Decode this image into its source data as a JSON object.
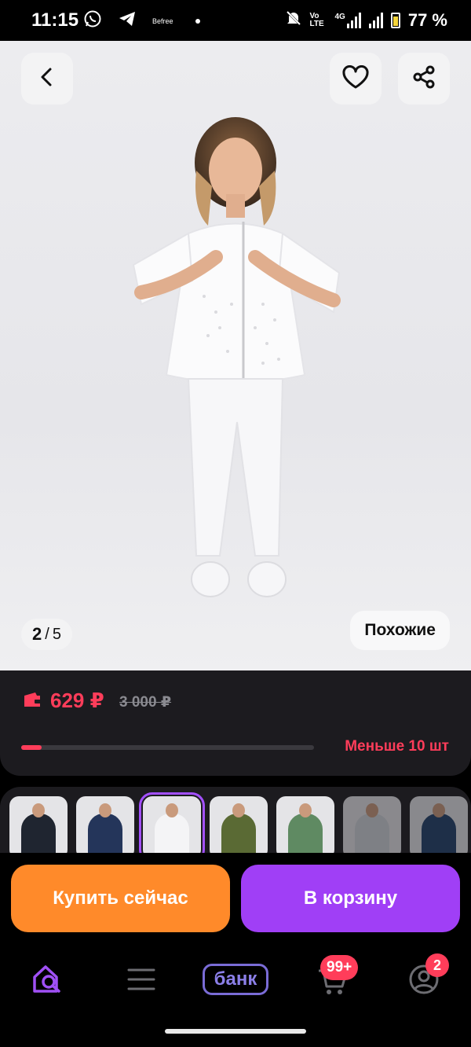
{
  "status_bar": {
    "time": "11:15",
    "small_label": "Befree",
    "network_label": "Vo LTE",
    "network_type": "4G",
    "battery": "77 %",
    "icons": [
      "whatsapp-icon",
      "telegram-icon",
      "mute-icon",
      "signal-icon",
      "battery-icon"
    ]
  },
  "gallery": {
    "current": "2",
    "separator": "/",
    "total": "5",
    "similar_label": "Похожие",
    "icons": [
      "back-icon",
      "heart-icon",
      "share-icon"
    ]
  },
  "price": {
    "current": "629 ₽",
    "old": "3 000 ₽",
    "stock_text": "Меньше 10 шт",
    "stock_level": 0.07,
    "accent": "#ff3d5a"
  },
  "variants": [
    {
      "color": "#1f2530",
      "state": "default"
    },
    {
      "color": "#24355a",
      "state": "default"
    },
    {
      "color": "#f4f4f6",
      "state": "active"
    },
    {
      "color": "#5a6a34",
      "state": "default"
    },
    {
      "color": "#5f8a62",
      "state": "default"
    },
    {
      "color": "#cfd3da",
      "state": "dim"
    },
    {
      "color": "#22406a",
      "state": "dim"
    }
  ],
  "actions": {
    "buy_now": "Купить сейчас",
    "add_to_cart": "В корзину",
    "buy_color": "#ff8a2a",
    "cart_color": "#a03ff6"
  },
  "bottom_nav": {
    "bank_label": "банк",
    "cart_badge": "99+",
    "profile_badge": "2",
    "icons": [
      "home-search-icon",
      "menu-icon",
      "bank-icon",
      "cart-icon",
      "profile-icon"
    ]
  }
}
